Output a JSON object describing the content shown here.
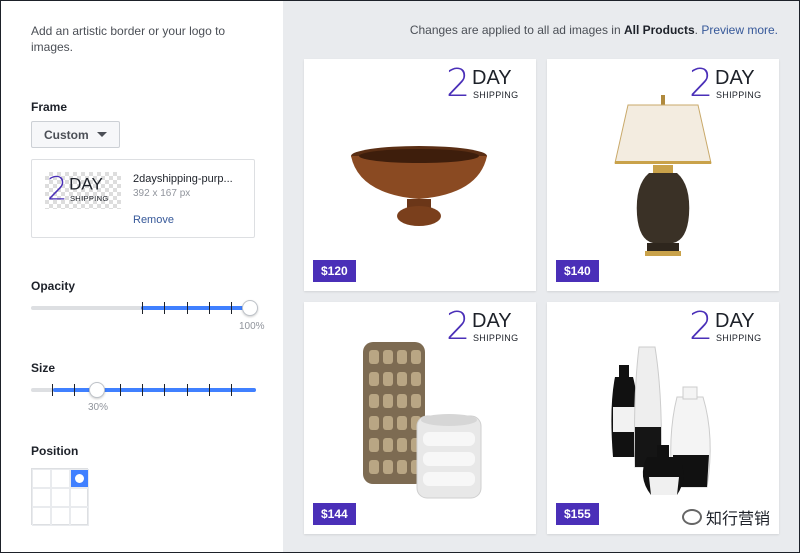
{
  "left_panel": {
    "intro": "Add an artistic border or your logo to images.",
    "frame_label": "Frame",
    "frame_select": "Custom",
    "logo_file": {
      "name": "2dayshipping-purp...",
      "dims": "392 x 167 px",
      "remove": "Remove",
      "thumb": {
        "two": "2",
        "day": "DAY",
        "shipping": "SHIPPING"
      }
    },
    "opacity": {
      "label": "Opacity",
      "value": 1.0,
      "value_text": "100%"
    },
    "size": {
      "label": "Size",
      "value": 0.3,
      "value_text": "30%"
    },
    "position": {
      "label": "Position",
      "selected": "top-right"
    }
  },
  "preview": {
    "notice_prefix": "Changes are applied to all ad images in ",
    "notice_bold": "All Products",
    "notice_suffix": ". ",
    "notice_link": "Preview more.",
    "badge": {
      "two": "2",
      "day": "DAY",
      "shipping": "SHIPPING"
    },
    "ads": [
      {
        "product": "wooden bowl",
        "price": "$120"
      },
      {
        "product": "table lamp",
        "price": "$140"
      },
      {
        "product": "metallic vases",
        "price": "$144"
      },
      {
        "product": "black and white vases",
        "price": "$155"
      }
    ]
  },
  "watermark": {
    "text": "知行营销"
  },
  "colors": {
    "accent": "#4a2fb8",
    "slider": "#4080ff",
    "link": "#365899"
  }
}
